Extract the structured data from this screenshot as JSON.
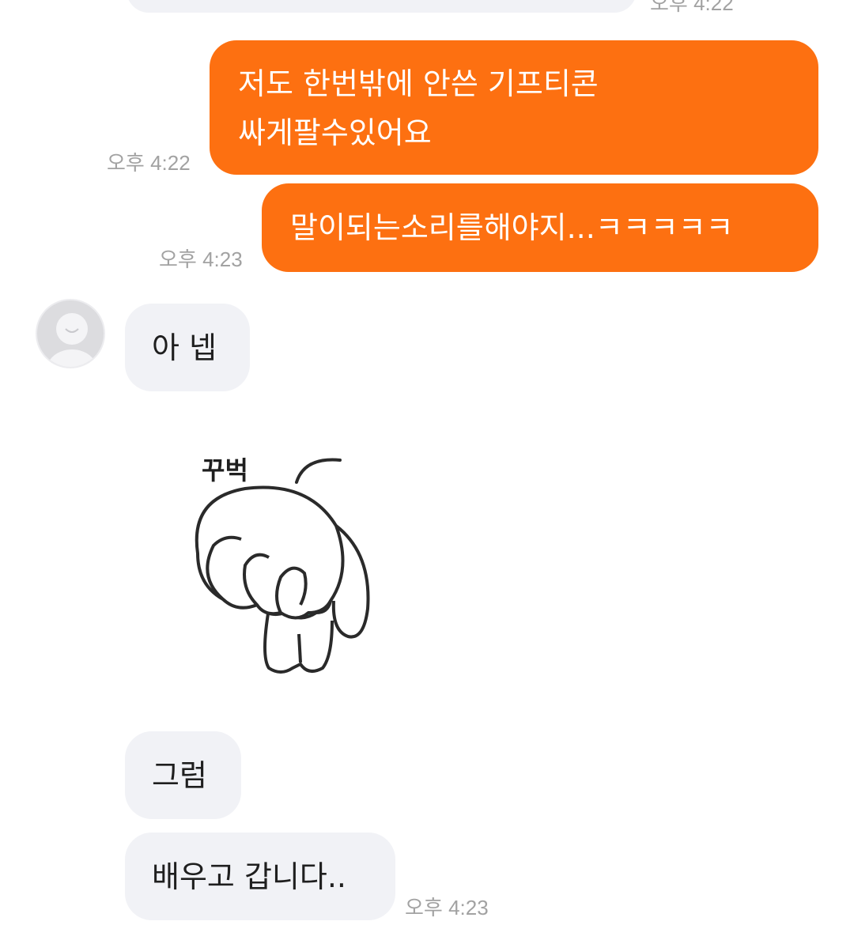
{
  "messages": {
    "top_time": "오후 4:22",
    "out_1": {
      "line1": "저도 한번밖에 안쓴 기프티콘",
      "line2": "싸게팔수있어요",
      "time": "오후 4:22"
    },
    "out_2": {
      "text": "말이되는소리를해야지...ㅋㅋㅋㅋㅋ",
      "time": "오후 4:23"
    },
    "in_1": {
      "text": "아 넵"
    },
    "sticker": {
      "caption": "꾸벅",
      "icon": "bowing-rabbit-sticker"
    },
    "in_2": {
      "text": "그럼"
    },
    "in_3": {
      "text": "배우고 갑니다..",
      "time": "오후 4:23"
    }
  },
  "colors": {
    "outgoing_bubble": "#fd7011",
    "incoming_bubble": "#f1f2f6",
    "timestamp": "#a2a2a2",
    "sticker_accent": "#2ec4a0"
  }
}
